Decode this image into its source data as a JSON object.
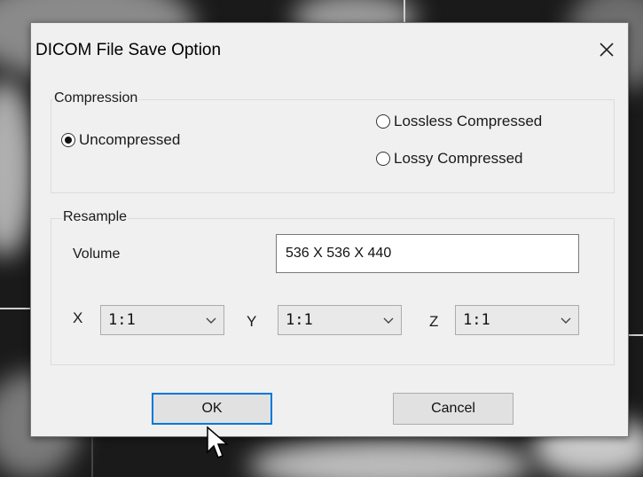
{
  "dialog": {
    "title": "DICOM File Save Option",
    "close_icon": "close-icon"
  },
  "compression": {
    "group_label": "Compression",
    "options": [
      {
        "label": "Uncompressed",
        "checked": true
      },
      {
        "label": "Lossless Compressed",
        "checked": false
      },
      {
        "label": "Lossy Compressed",
        "checked": false
      }
    ]
  },
  "resample": {
    "group_label": "Resample",
    "volume_label": "Volume",
    "volume_value": "536 X 536 X 440",
    "axes": [
      {
        "label": "X",
        "value": "1:1"
      },
      {
        "label": "Y",
        "value": "1:1"
      },
      {
        "label": "Z",
        "value": "1:1"
      }
    ]
  },
  "buttons": {
    "ok": "OK",
    "cancel": "Cancel"
  },
  "colors": {
    "dialog_bg": "#f0f0f0",
    "default_button_border": "#0078d7"
  }
}
